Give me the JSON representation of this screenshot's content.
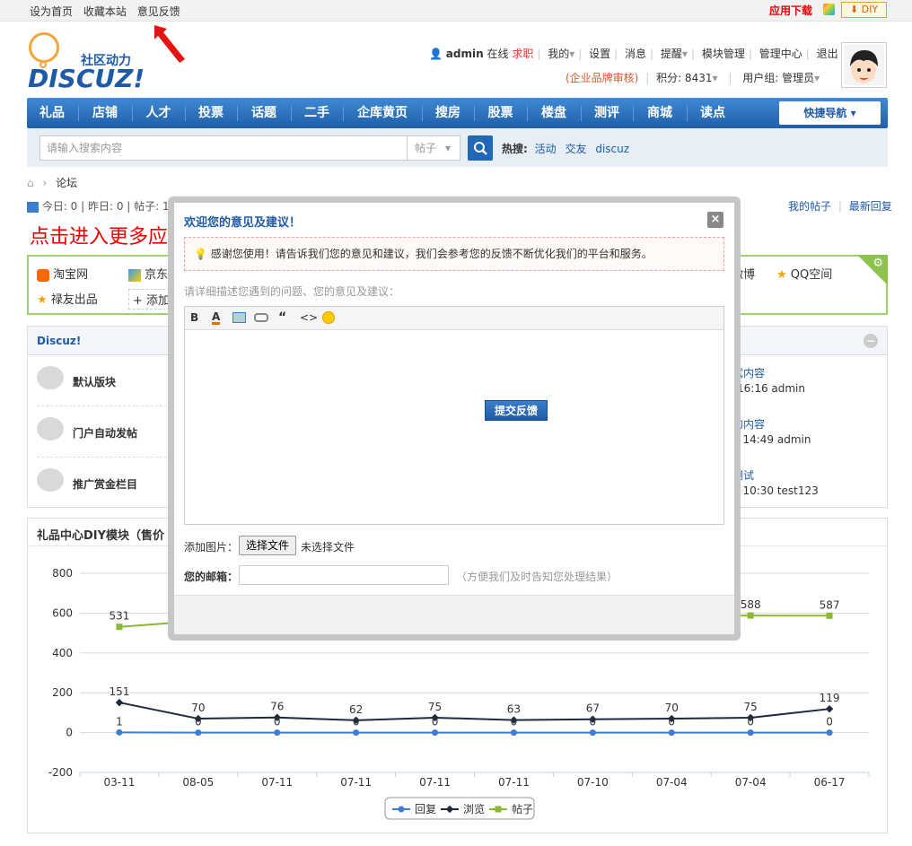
{
  "topbar": {
    "links": [
      "设为首页",
      "收藏本站",
      "意见反馈"
    ],
    "app_download": "应用下载",
    "diy": "DIY"
  },
  "logo": {
    "sub": "社区动力",
    "text": "DISCUZ!"
  },
  "user": {
    "name": "admin",
    "status": "在线",
    "job": "求职",
    "menu": [
      "我的",
      "设置",
      "消息",
      "提醒",
      "模块管理",
      "管理中心",
      "退出"
    ],
    "brand_review": "(企业品牌审核)",
    "points": "积分: 8431",
    "group": "用户组: 管理员"
  },
  "nav": {
    "items": [
      "礼品",
      "店铺",
      "人才",
      "投票",
      "话题",
      "二手",
      "企库黄页",
      "搜房",
      "股票",
      "楼盘",
      "测评",
      "商城",
      "读点"
    ],
    "quick": "快捷导航"
  },
  "search": {
    "placeholder": "请输入搜索内容",
    "type": "帖子",
    "hot_label": "热搜:",
    "hot": [
      "活动",
      "交友",
      "discuz"
    ]
  },
  "breadcrumb": {
    "current": "论坛"
  },
  "stats": {
    "text": "今日: 0 | 昨日: 0 | 帖子: 1..."
  },
  "post_links": {
    "mine": "我的帖子",
    "latest": "最新回复"
  },
  "banner_text": "点击进入更多应",
  "links_box": {
    "items": [
      "淘宝网",
      "京东",
      "禄友出品",
      "+ 添加",
      "微博",
      "QQ空间"
    ]
  },
  "forums": {
    "title": "Discuz!",
    "items": [
      {
        "name": "默认版块",
        "latest_title": "试内容",
        "latest_meta": "16:16 admin"
      },
      {
        "name": "门户自动发帖",
        "latest_title": "的内容",
        "latest_meta": "7 14:49 admin"
      },
      {
        "name": "推广赏金栏目",
        "latest_title": "测试",
        "latest_meta": "7 10:30 test123"
      }
    ]
  },
  "chart_block": {
    "title": "礼品中心DIY模块（售价"
  },
  "chart_data": {
    "type": "line",
    "categories": [
      "03-11",
      "08-05",
      "07-11",
      "07-11",
      "07-11",
      "07-11",
      "07-10",
      "07-04",
      "07-04",
      "06-17"
    ],
    "series": [
      {
        "name": "回复",
        "color": "#3b7dd8",
        "values": [
          1,
          0,
          0,
          0,
          0,
          0,
          0,
          0,
          0,
          0
        ]
      },
      {
        "name": "浏览",
        "color": "#1c2a3f",
        "values": [
          151,
          70,
          76,
          62,
          75,
          63,
          67,
          70,
          75,
          119
        ]
      },
      {
        "name": "帖子",
        "color": "#8ab832",
        "values": [
          531,
          560,
          570,
          575,
          578,
          580,
          582,
          585,
          588,
          587
        ]
      }
    ],
    "visible_series_labels": {
      "帖子": [
        531,
        null,
        null,
        null,
        null,
        null,
        null,
        null,
        588,
        587
      ]
    },
    "ylim": [
      -200,
      800
    ],
    "yticks": [
      800,
      600,
      400,
      200,
      0,
      -200
    ],
    "legend": "bottom-center",
    "grid": true
  },
  "dialog": {
    "title": "欢迎您的意见及建议！",
    "notice": "感谢您使用！请告诉我们您的意见和建议，我们会参考您的反馈不断优化我们的平台和服务。",
    "hint": "请详细描述您遇到的问题、您的意见及建议：",
    "toolbar": [
      "B",
      "A",
      "image",
      "link",
      "“",
      "<>",
      "emoji"
    ],
    "add_image_label": "添加图片：",
    "file_button": "选择文件",
    "file_status": "未选择文件",
    "email_label": "您的邮箱：",
    "email_hint": "（方便我们及时告知您处理结果）",
    "submit": "提交反馈",
    "close": "×"
  }
}
